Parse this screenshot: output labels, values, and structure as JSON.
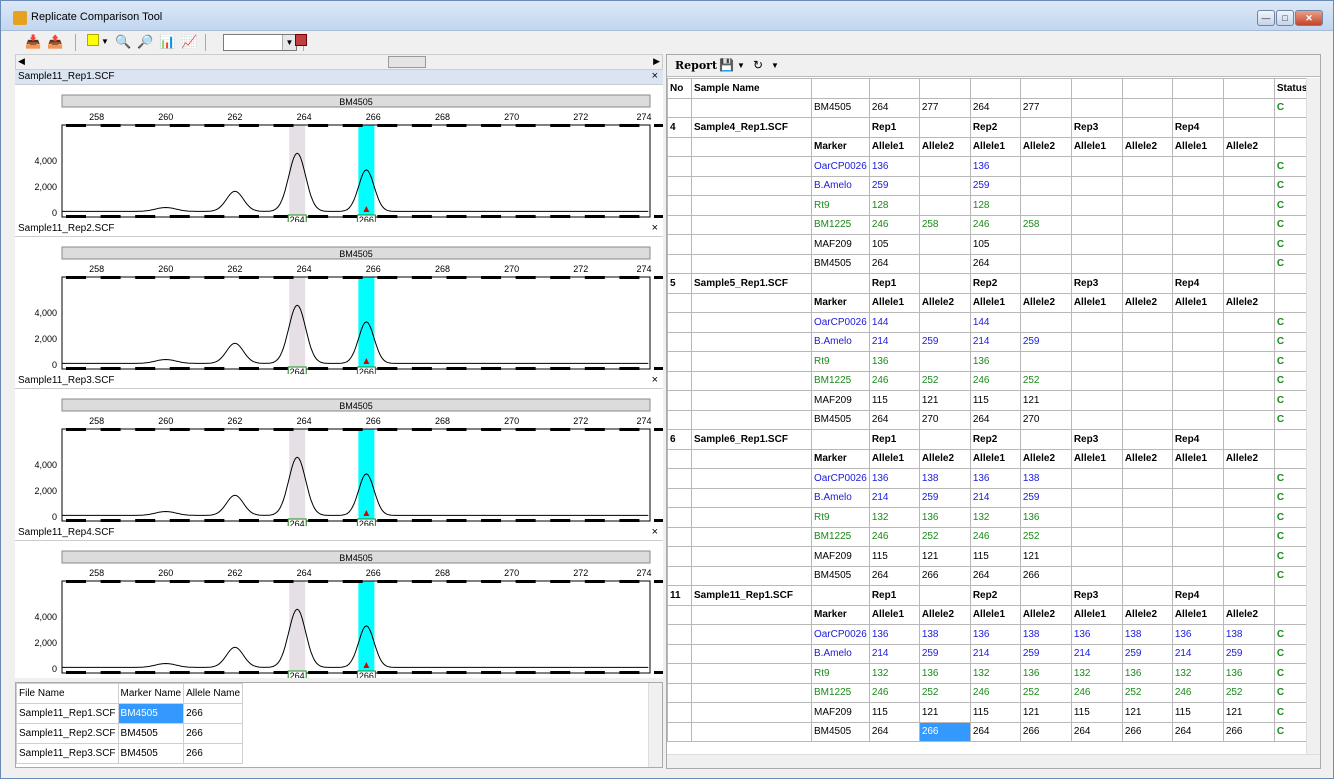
{
  "window": {
    "title": "Replicate Comparison Tool"
  },
  "toolbar": {
    "icons": [
      "import-icon",
      "export-icon",
      "color-icon",
      "zoom-in-icon",
      "zoom-out-icon",
      "scale-icon",
      "overlay-icon",
      "settings-icon"
    ],
    "combo_value": ""
  },
  "colors": {
    "peak_gray": "#e6e0e6",
    "peak_cyan": "#00ffff",
    "blue": "#1a1adc",
    "green": "#1a8a1a",
    "selection": "#3399ff"
  },
  "panels": [
    {
      "file": "Sample11_Rep1.SCF",
      "marker": "BM4505",
      "labels": [
        "264",
        "266"
      ]
    },
    {
      "file": "Sample11_Rep2.SCF",
      "marker": "BM4505",
      "labels": [
        "264",
        "266"
      ]
    },
    {
      "file": "Sample11_Rep3.SCF",
      "marker": "BM4505",
      "labels": [
        "264",
        "266"
      ]
    },
    {
      "file": "Sample11_Rep4.SCF",
      "marker": "BM4505",
      "labels": [
        "264",
        "266"
      ]
    }
  ],
  "axis": {
    "x_ticks": [
      "258",
      "260",
      "262",
      "264",
      "266",
      "268",
      "270",
      "272",
      "274"
    ],
    "y_ticks": [
      "4,000",
      "2,000",
      "0"
    ]
  },
  "allele_table": {
    "headers": [
      "File Name",
      "Marker Name",
      "Allele Name"
    ],
    "rows": [
      [
        "Sample11_Rep1.SCF",
        "BM4505",
        "266"
      ],
      [
        "Sample11_Rep2.SCF",
        "BM4505",
        "266"
      ],
      [
        "Sample11_Rep3.SCF",
        "BM4505",
        "266"
      ]
    ]
  },
  "report": {
    "label": "Report",
    "headers": [
      "No",
      "Sample Name",
      "",
      "",
      "",
      "",
      "",
      "",
      "",
      "",
      "",
      "Status"
    ],
    "rep_labels": [
      "Rep1",
      "Rep2",
      "Rep3",
      "Rep4"
    ],
    "allele_labels": [
      "Allele1",
      "Allele2"
    ],
    "marker_label": "Marker",
    "pre": [
      [
        "BM4505",
        "264",
        "277",
        "264",
        "277",
        "",
        "",
        "",
        "",
        "C",
        "black"
      ]
    ],
    "samples": [
      {
        "no": "4",
        "name": "Sample4_Rep1.SCF",
        "reps": [
          "Rep1",
          "Rep2",
          "Rep3",
          "Rep4"
        ],
        "rows": [
          [
            "OarCP0026",
            "136",
            "",
            "136",
            "",
            "",
            "",
            "",
            "",
            "C",
            "blue"
          ],
          [
            "B.Amelo",
            "259",
            "",
            "259",
            "",
            "",
            "",
            "",
            "",
            "C",
            "blue"
          ],
          [
            "Rt9",
            "128",
            "",
            "128",
            "",
            "",
            "",
            "",
            "",
            "C",
            "green"
          ],
          [
            "BM1225",
            "246",
            "258",
            "246",
            "258",
            "",
            "",
            "",
            "",
            "C",
            "green"
          ],
          [
            "MAF209",
            "105",
            "",
            "105",
            "",
            "",
            "",
            "",
            "",
            "C",
            "black"
          ],
          [
            "BM4505",
            "264",
            "",
            "264",
            "",
            "",
            "",
            "",
            "",
            "C",
            "black"
          ]
        ]
      },
      {
        "no": "5",
        "name": "Sample5_Rep1.SCF",
        "reps": [
          "Rep1",
          "Rep2",
          "Rep3",
          "Rep4"
        ],
        "rows": [
          [
            "OarCP0026",
            "144",
            "",
            "144",
            "",
            "",
            "",
            "",
            "",
            "C",
            "blue"
          ],
          [
            "B.Amelo",
            "214",
            "259",
            "214",
            "259",
            "",
            "",
            "",
            "",
            "C",
            "blue"
          ],
          [
            "Rt9",
            "136",
            "",
            "136",
            "",
            "",
            "",
            "",
            "",
            "C",
            "green"
          ],
          [
            "BM1225",
            "246",
            "252",
            "246",
            "252",
            "",
            "",
            "",
            "",
            "C",
            "green"
          ],
          [
            "MAF209",
            "115",
            "121",
            "115",
            "121",
            "",
            "",
            "",
            "",
            "C",
            "black"
          ],
          [
            "BM4505",
            "264",
            "270",
            "264",
            "270",
            "",
            "",
            "",
            "",
            "C",
            "black"
          ]
        ]
      },
      {
        "no": "6",
        "name": "Sample6_Rep1.SCF",
        "reps": [
          "Rep1",
          "Rep2",
          "Rep3",
          "Rep4"
        ],
        "rows": [
          [
            "OarCP0026",
            "136",
            "138",
            "136",
            "138",
            "",
            "",
            "",
            "",
            "C",
            "blue"
          ],
          [
            "B.Amelo",
            "214",
            "259",
            "214",
            "259",
            "",
            "",
            "",
            "",
            "C",
            "blue"
          ],
          [
            "Rt9",
            "132",
            "136",
            "132",
            "136",
            "",
            "",
            "",
            "",
            "C",
            "green"
          ],
          [
            "BM1225",
            "246",
            "252",
            "246",
            "252",
            "",
            "",
            "",
            "",
            "C",
            "green"
          ],
          [
            "MAF209",
            "115",
            "121",
            "115",
            "121",
            "",
            "",
            "",
            "",
            "C",
            "black"
          ],
          [
            "BM4505",
            "264",
            "266",
            "264",
            "266",
            "",
            "",
            "",
            "",
            "C",
            "black"
          ]
        ]
      },
      {
        "no": "11",
        "name": "Sample11_Rep1.SCF",
        "reps": [
          "Rep1",
          "Rep2",
          "Rep3",
          "Rep4"
        ],
        "rows": [
          [
            "OarCP0026",
            "136",
            "138",
            "136",
            "138",
            "136",
            "138",
            "136",
            "138",
            "C",
            "blue"
          ],
          [
            "B.Amelo",
            "214",
            "259",
            "214",
            "259",
            "214",
            "259",
            "214",
            "259",
            "C",
            "blue"
          ],
          [
            "Rt9",
            "132",
            "136",
            "132",
            "136",
            "132",
            "136",
            "132",
            "136",
            "C",
            "green"
          ],
          [
            "BM1225",
            "246",
            "252",
            "246",
            "252",
            "246",
            "252",
            "246",
            "252",
            "C",
            "green"
          ],
          [
            "MAF209",
            "115",
            "121",
            "115",
            "121",
            "115",
            "121",
            "115",
            "121",
            "C",
            "black"
          ],
          [
            "BM4505",
            "264",
            "266",
            "264",
            "266",
            "264",
            "266",
            "264",
            "266",
            "C",
            "black"
          ]
        ]
      }
    ],
    "selected_cell": {
      "sample": 3,
      "row": 5,
      "col": 2
    }
  }
}
